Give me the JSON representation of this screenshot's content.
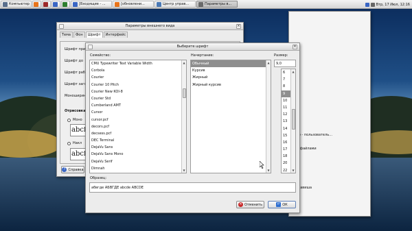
{
  "taskbar": {
    "items": [
      {
        "label": "Компьютер",
        "color": "#5a6f8c"
      },
      {
        "label": "",
        "color": "#e8741a"
      },
      {
        "label": "",
        "color": "#9c2a2a"
      },
      {
        "label": "",
        "color": "#3a66c4"
      },
      {
        "label": "",
        "color": "#2f7f2f"
      },
      {
        "label": "[Входящие - ...",
        "color": "#3a66c4"
      },
      {
        "label": "[обновлени...",
        "color": "#e8741a"
      },
      {
        "label": "Центр управ...",
        "color": "#4a79b5"
      },
      {
        "label": "Параметры в...",
        "color": "#6a6a6a"
      }
    ],
    "clock": "Втр, 17 Июл, 12:16"
  },
  "appearance": {
    "title": "Параметры внешнего вида",
    "tabs": [
      "Тема",
      "Фон",
      "Шрифт",
      "Интерфейс"
    ],
    "labels": [
      "Шрифт при",
      "Шрифт до",
      "Шрифт раб",
      "Шрифт заго",
      "Моноширин"
    ],
    "render_title": "Отрисовка",
    "opt1": "Моно",
    "sample1": "abcfe",
    "opt2": "Накл",
    "sample2": "abcfe",
    "help_label": "Справка"
  },
  "bg_texts": [
    "мо - пользователь...",
    "ю файлами",
    "клавиша"
  ],
  "dialog": {
    "title": "Выберите шрифт",
    "family_label": "Семейство:",
    "style_label": "Начертание:",
    "size_label": "Размер:",
    "families": [
      "CMU Typewriter Text Variable Width",
      "Corbola",
      "Courier",
      "Courier 10 Pitch",
      "Courier New KOI-8",
      "Courier Std",
      "Cumberland AMT",
      "Cursor",
      "cursor.pcf",
      "decors.pcf",
      "decsess.pcf",
      "DEC Terminal",
      "DejaVu Sans",
      "DejaVu Sans Mono",
      "DejaVu Serif",
      "Dimnah"
    ],
    "styles": [
      "Обычный",
      "Курсив",
      "Жирный",
      "Жирный курсив"
    ],
    "size_value": "9,0",
    "sizes": [
      "6",
      "7",
      "8",
      "9",
      "10",
      "11",
      "12",
      "13",
      "14",
      "15",
      "16",
      "17",
      "18",
      "20",
      "22"
    ],
    "sample_label": "Образец:",
    "sample_text": "абвгде АБВГДЕ abcde ABCDE",
    "cancel_label": "Отменить",
    "ok_label": "ОК"
  }
}
